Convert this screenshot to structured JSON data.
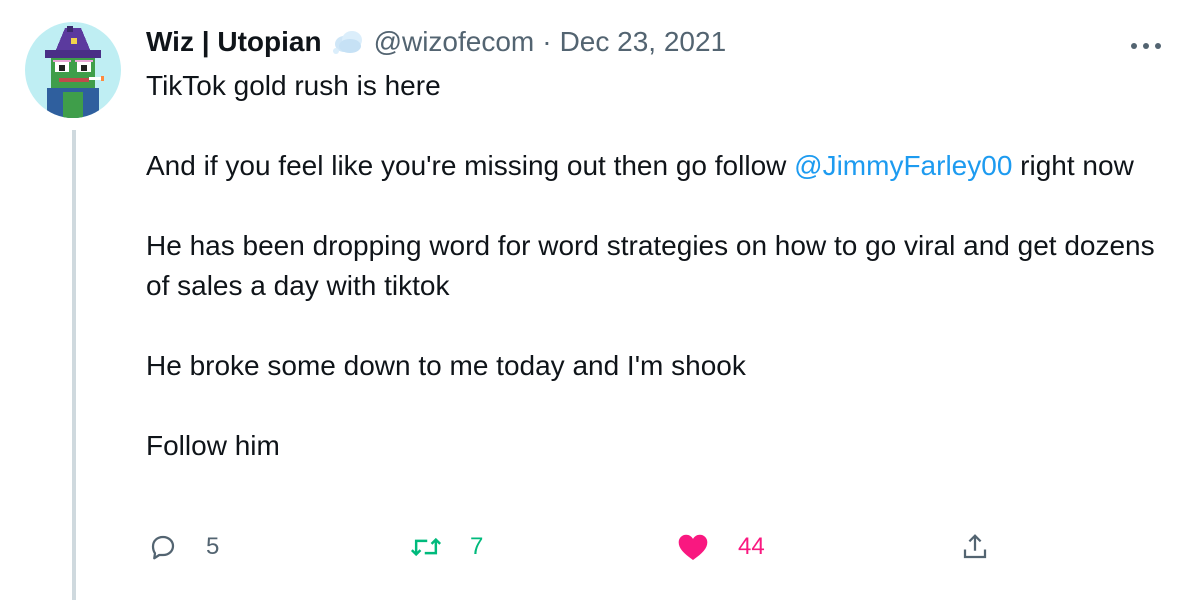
{
  "author": {
    "display_name": "Wiz | Utopian",
    "handle": "@wizofecom",
    "separator": "·",
    "date": "Dec 23, 2021"
  },
  "tweet": {
    "line1": "TikTok gold rush is here",
    "line2_before": "And if you feel like you're missing out then go follow ",
    "line2_mention": "@JimmyFarley00",
    "line2_after": " right now",
    "line3": "He has been dropping word for word strategies on how to go viral and get dozens of sales a day with tiktok",
    "line4": "He broke some down to me today and I'm shook",
    "line5": "Follow him"
  },
  "actions": {
    "replies": "5",
    "retweets": "7",
    "likes": "44"
  },
  "icons": {
    "badge": "cloud-badge-icon",
    "more": "more-icon",
    "reply": "reply-icon",
    "retweet": "retweet-icon",
    "like": "heart-icon",
    "share": "share-icon"
  },
  "colors": {
    "link": "#1d9bf0",
    "secondary_text": "#536471",
    "retweet": "#00ba7c",
    "like": "#f91880",
    "thread_line": "#cfd9de"
  }
}
